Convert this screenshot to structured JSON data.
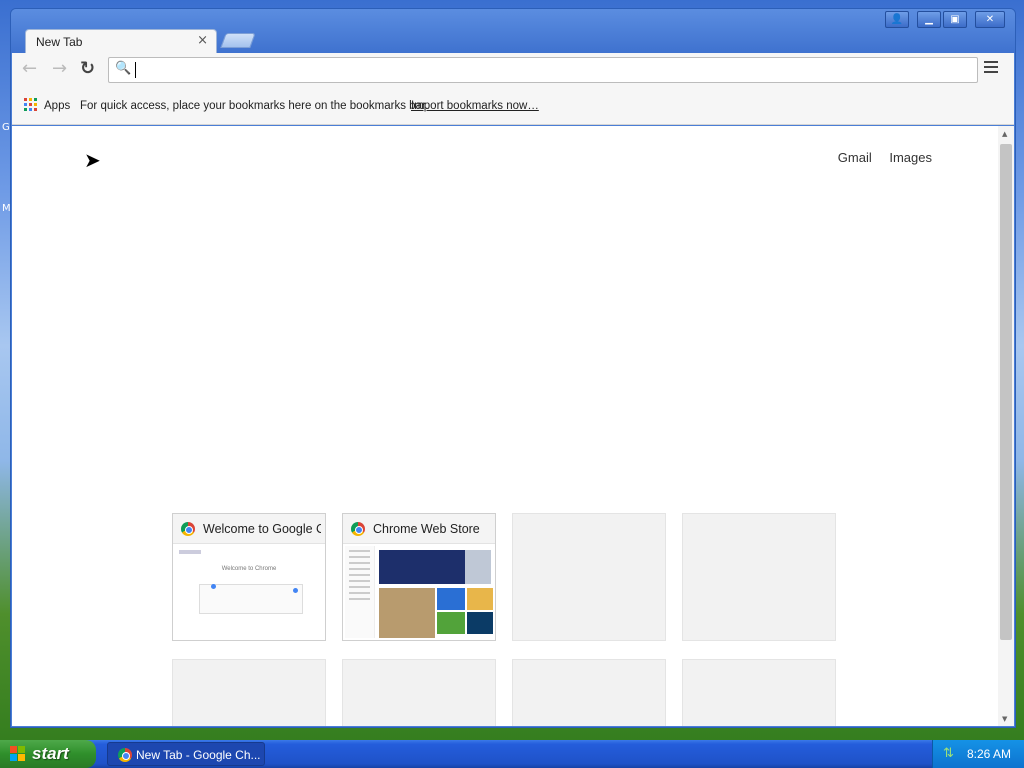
{
  "browser": {
    "window_buttons": {
      "profile_icon": "person-icon",
      "minimize_icon": "minimize-icon",
      "maximize_icon": "maximize-icon",
      "close_icon": "close-icon"
    },
    "tab": {
      "title": "New Tab",
      "close_glyph": "×"
    },
    "toolbar": {
      "back_glyph": "←",
      "forward_glyph": "→",
      "reload_glyph": "↻",
      "omnibox_value": "",
      "search_glyph": "🔍"
    },
    "bookmarks_bar": {
      "apps_label": "Apps",
      "hint": "For quick access, place your bookmarks here on the bookmarks bar.",
      "import_link": "Import bookmarks now…"
    },
    "page": {
      "gmail_link": "Gmail",
      "images_link": "Images",
      "tiles": [
        {
          "title": "Welcome to Google C",
          "thumb_text": "Welcome to Chrome"
        },
        {
          "title": "Chrome Web Store"
        }
      ]
    }
  },
  "taskbar": {
    "start_label": "start",
    "task_label": "New Tab - Google Ch...",
    "clock": "8:26 AM"
  },
  "colors": {
    "xp_blue": "#245ddb",
    "start_green": "#2f8f2b",
    "chrome_frame": "#4a7ed6"
  }
}
